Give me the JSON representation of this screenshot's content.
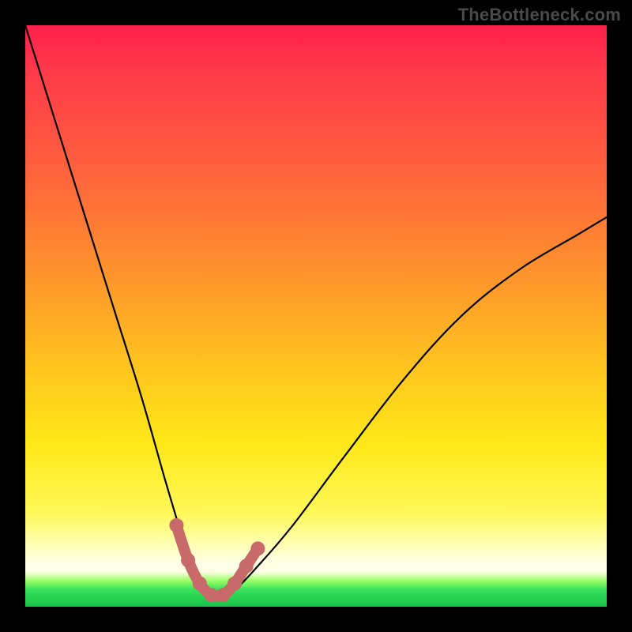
{
  "watermark": "TheBottleneck.com",
  "chart_data": {
    "type": "line",
    "title": "",
    "xlabel": "",
    "ylabel": "",
    "xlim": [
      0,
      100
    ],
    "ylim": [
      0,
      100
    ],
    "grid": false,
    "legend": false,
    "series": [
      {
        "name": "bottleneck-curve",
        "x": [
          0,
          5,
          10,
          15,
          20,
          24,
          27,
          29,
          31,
          33,
          36,
          40,
          46,
          55,
          65,
          75,
          85,
          95,
          100
        ],
        "values": [
          100,
          84,
          68,
          52,
          36,
          22,
          12,
          6,
          3,
          2,
          3,
          7,
          14,
          26,
          39,
          50,
          58,
          64,
          67
        ]
      }
    ],
    "markers": {
      "name": "optimal-range",
      "x": [
        26,
        28,
        30,
        32,
        34,
        36,
        38,
        40
      ],
      "values": [
        14,
        8,
        4,
        2,
        2,
        4,
        7,
        10
      ]
    },
    "background_gradient": {
      "stops": [
        {
          "pos": 0.0,
          "color": "#ff1f4a"
        },
        {
          "pos": 0.4,
          "color": "#ff8b2f"
        },
        {
          "pos": 0.72,
          "color": "#ffe818"
        },
        {
          "pos": 0.92,
          "color": "#ffffe6"
        },
        {
          "pos": 1.0,
          "color": "#18c24a"
        }
      ]
    }
  }
}
